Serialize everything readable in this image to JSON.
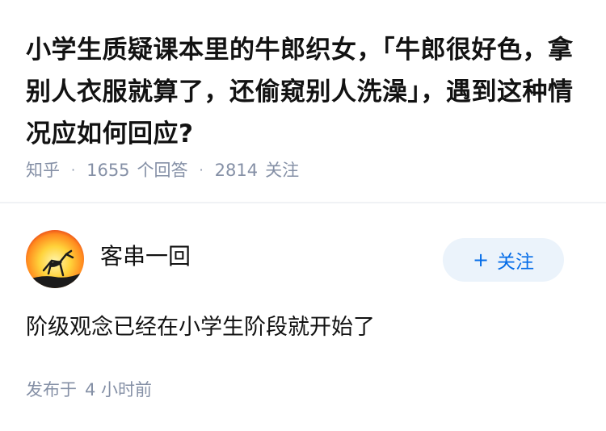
{
  "question": {
    "title": "小学生质疑课本里的牛郎织女，「牛郎很好色，拿别人衣服就算了，还偷窥别人洗澡」，遇到这种情况应如何回应?",
    "source": "知乎",
    "answers_count": "1655",
    "answers_label": "个回答",
    "followers_count": "2814",
    "followers_label": "关注"
  },
  "answer": {
    "author_name": "客串一回",
    "avatar_icon": "mantis-sunset-avatar",
    "follow_label": "关注",
    "follow_icon": "plus-icon",
    "content": "阶级观念已经在小学生阶段就开始了",
    "published_label": "发布于",
    "published_time": "4 小时前"
  },
  "colors": {
    "accent": "#056de8",
    "button_bg": "#ebf3fb",
    "meta_text": "#8590a6",
    "title_text": "#121212"
  }
}
